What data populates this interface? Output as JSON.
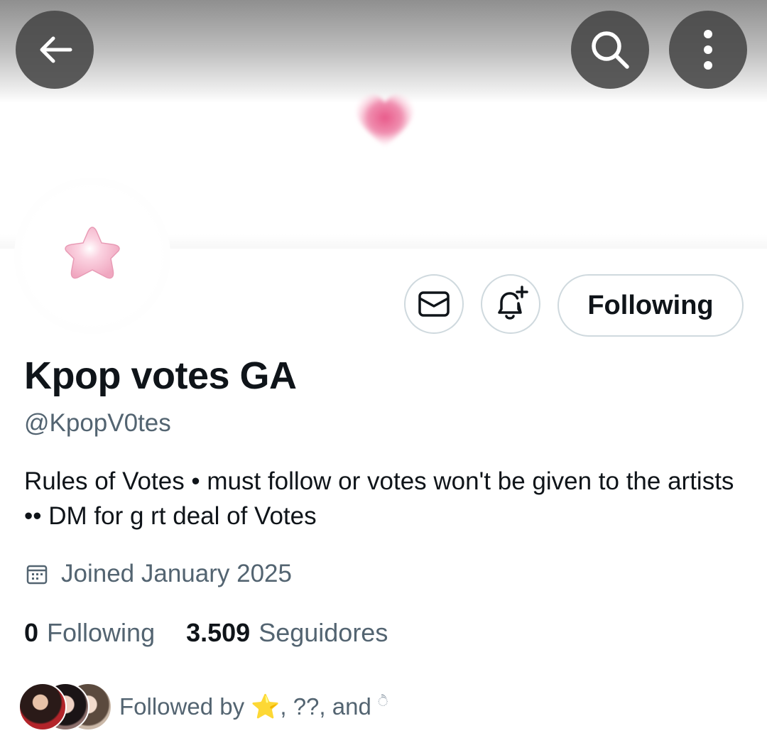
{
  "header": {
    "back_icon": "arrow-left-icon",
    "search_icon": "search-icon",
    "more_icon": "more-vertical-icon",
    "banner_decoration": "pink-heart",
    "avatar_decoration": "pink-star"
  },
  "actions": {
    "message_icon": "envelope-icon",
    "notify_icon": "bell-plus-icon",
    "follow_label": "Following"
  },
  "profile": {
    "display_name": "Kpop votes GA",
    "handle": "@KpopV0tes",
    "bio": "Rules of Votes • must follow or votes won't be given to the artists ••  DM for g rt deal of Votes",
    "joined": "Joined January 2025",
    "joined_icon": "calendar-icon"
  },
  "stats": {
    "following_count": "0",
    "following_label": "Following",
    "followers_count": "3.509",
    "followers_label": "Seguidores"
  },
  "followed_by": {
    "prefix": "Followed by ",
    "name1": "⭐",
    "sep1": ", ",
    "name2": "??",
    "sep2": ", and ",
    "name3": "ੈ"
  }
}
